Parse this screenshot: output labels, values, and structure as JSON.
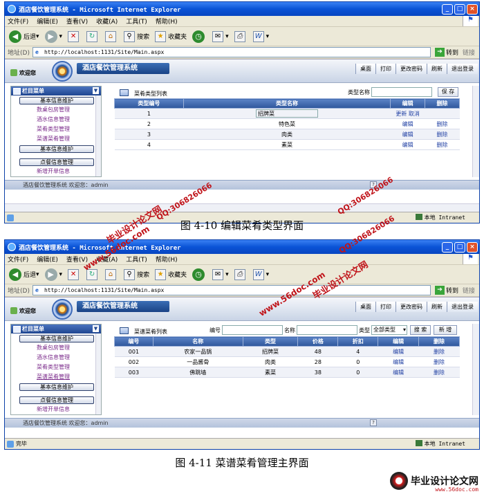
{
  "browser": {
    "menu": [
      "文件(F)",
      "编辑(E)",
      "查看(V)",
      "收藏(A)",
      "工具(T)",
      "帮助(H)"
    ],
    "toolbar": {
      "back": "后退",
      "search": "搜索",
      "favorites": "收藏夹"
    },
    "address_label": "地址(D)",
    "url": "http://localhost:1131/Site/Main.aspx",
    "go": "转到",
    "links": "链接",
    "zone": "本地 Intranet"
  },
  "app": {
    "welcome": "欢迎您",
    "system_name": "酒店餐饮管理系统",
    "nav": [
      "桌面",
      "打印",
      "更改密码",
      "刷新",
      "退出登录"
    ],
    "sidebar": {
      "header": "栏目菜单",
      "group1": "基本信息维护",
      "items": [
        "数桌包房管理",
        "酒水信息管理",
        "菜肴类型管理",
        "菜谱菜肴管理"
      ],
      "group2": "基本信息维护",
      "group3": "点餐信息管理",
      "item_more": "新增开单信息"
    },
    "statusline": "酒店餐饮管理系统 欢迎您：admin",
    "statusline_mark": "?"
  },
  "screen1": {
    "window_title": "酒店餐饮管理系统 - Microsoft Internet Explorer",
    "panel_title": "菜肴类型列表",
    "search_label": "类型名称",
    "save_button": "保 存",
    "columns": [
      "类型编号",
      "类型名称",
      "编辑",
      "删除"
    ],
    "rows": [
      {
        "id": "1",
        "name": "招牌菜",
        "edit": "更新",
        "cancel": "取消",
        "del": ""
      },
      {
        "id": "2",
        "name": "特色菜",
        "edit": "编辑",
        "cancel": "",
        "del": "删除"
      },
      {
        "id": "3",
        "name": "肉类",
        "edit": "编辑",
        "cancel": "",
        "del": "删除"
      },
      {
        "id": "4",
        "name": "素菜",
        "edit": "编辑",
        "cancel": "",
        "del": "删除"
      }
    ],
    "caption": "图 4-10 编辑菜肴类型界面"
  },
  "screen2": {
    "window_title": "酒店餐饮管理系统 - Microsoft Internet Explorer",
    "panel_title": "菜谱菜肴列表",
    "filter": {
      "id_label": "编号",
      "name_label": "名称",
      "type_label": "类型",
      "type_value": "全部类型",
      "search_button": "搜 索",
      "add_button": "新 增"
    },
    "ie_status": "完毕",
    "columns": [
      "编号",
      "名称",
      "类型",
      "价格",
      "折扣",
      "编辑",
      "删除"
    ],
    "rows": [
      {
        "id": "001",
        "name": "农家一品锅",
        "type": "招牌菜",
        "price": "48",
        "discount": "4",
        "edit": "编辑",
        "del": "删除"
      },
      {
        "id": "002",
        "name": "一品酱骨",
        "type": "肉类",
        "price": "28",
        "discount": "0",
        "edit": "编辑",
        "del": "删除"
      },
      {
        "id": "003",
        "name": "佛跳墙",
        "type": "素菜",
        "price": "38",
        "discount": "0",
        "edit": "编辑",
        "del": "删除"
      }
    ],
    "caption": "图 4-11 菜谱菜肴管理主界面"
  },
  "watermarks": {
    "brand": "毕业设计论文网",
    "site": "www.56doc.com",
    "qq": "QQ:306826066",
    "footer_brand": "毕业设计论文网",
    "footer_url": "www.56doc.com"
  },
  "colors": {
    "title_blue": "#0a53d6",
    "grid_header": "#2f579c",
    "link": "#1f3fa3",
    "watermark_red": "#c0141a"
  }
}
